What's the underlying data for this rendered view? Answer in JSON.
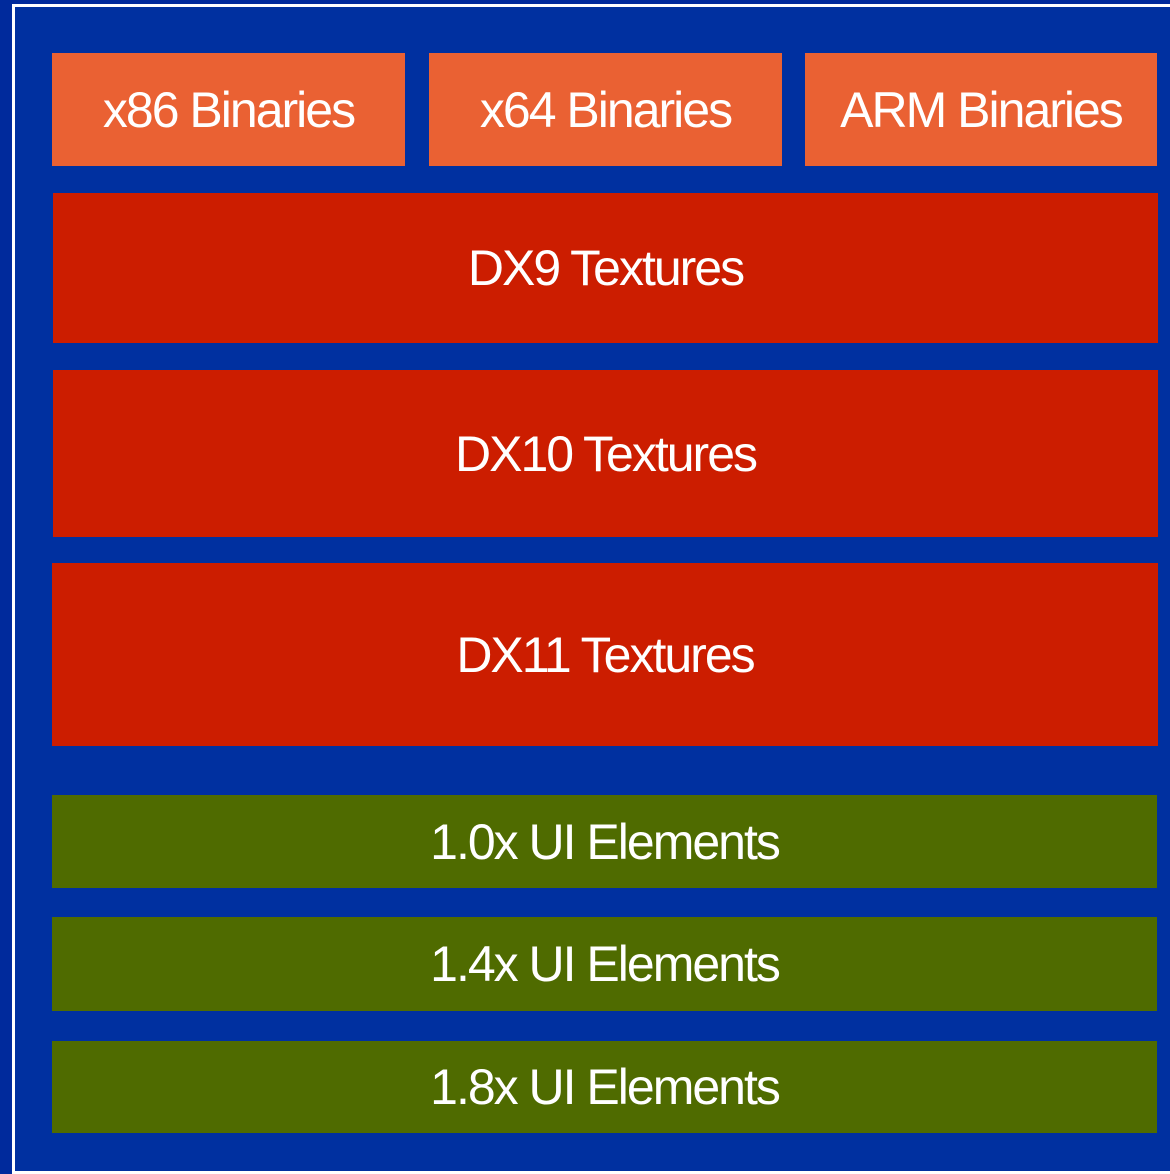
{
  "colors": {
    "background": "#0030a0",
    "frame_border": "#ffffff",
    "binaries": "#ea6133",
    "textures": "#cc1d00",
    "ui_elements": "#4f6b00",
    "text": "#ffffff"
  },
  "binaries": [
    {
      "label": "x86 Binaries"
    },
    {
      "label": "x64 Binaries"
    },
    {
      "label": "ARM Binaries"
    }
  ],
  "textures": [
    {
      "label": "DX9 Textures"
    },
    {
      "label": "DX10 Textures"
    },
    {
      "label": "DX11 Textures"
    }
  ],
  "ui_elements": [
    {
      "label": "1.0x UI Elements"
    },
    {
      "label": "1.4x UI Elements"
    },
    {
      "label": "1.8x UI Elements"
    }
  ]
}
